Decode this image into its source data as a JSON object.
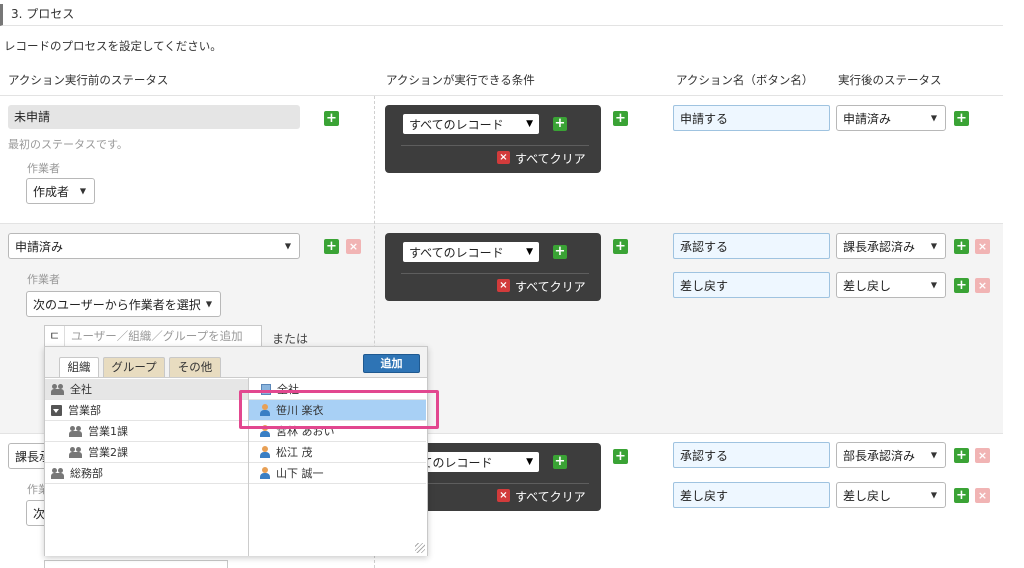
{
  "section": {
    "title": "3. プロセス",
    "description": "レコードのプロセスを設定してください。"
  },
  "columns": {
    "status_before": "アクション実行前のステータス",
    "condition": "アクションが実行できる条件",
    "action_name": "アクション名（ボタン名）",
    "status_after": "実行後のステータス"
  },
  "rows": [
    {
      "status": "未申請",
      "note": "最初のステータスです。",
      "assignee_label": "作業者",
      "assignee_value": "作成者",
      "condition_value": "すべてのレコード",
      "clear_label": "すべてクリア",
      "actions": [
        {
          "name": "申請する",
          "next": "申請済み"
        }
      ]
    },
    {
      "status": "申請済み",
      "assignee_label": "作業者",
      "assignee_value": "次のユーザーから作業者を選択",
      "assignee_input_placeholder": "ユーザー／組織／グループを追加",
      "or_label": "または",
      "condition_value": "すべてのレコード",
      "clear_label": "すべてクリア",
      "actions": [
        {
          "name": "承認する",
          "next": "課長承認済み"
        },
        {
          "name": "差し戻す",
          "next": "差し戻し"
        }
      ]
    },
    {
      "status": "課長承",
      "assignee_label": "作業",
      "assignee_value": "次",
      "condition_value": "べてのレコード",
      "clear_label": "すべてクリア",
      "actions": [
        {
          "name": "承認する",
          "next": "部長承認済み"
        },
        {
          "name": "差し戻す",
          "next": "差し戻し"
        }
      ]
    }
  ],
  "picker": {
    "tabs": [
      "組織",
      "グループ",
      "その他"
    ],
    "add_button": "追加",
    "orgs": [
      {
        "label": "全社",
        "icon": "group-icon",
        "selected": true
      },
      {
        "label": "営業部",
        "icon": "expand-icon"
      },
      {
        "label": "営業1課",
        "icon": "group-icon"
      },
      {
        "label": "営業2課",
        "icon": "group-icon"
      },
      {
        "label": "総務部",
        "icon": "group-icon"
      }
    ],
    "users": [
      {
        "label": "全社",
        "icon": "org-icon"
      },
      {
        "label": "笹川 楽衣",
        "icon": "person-icon",
        "highlighted": true
      },
      {
        "label": "宮林 あおい",
        "icon": "person-icon"
      },
      {
        "label": "松江 茂",
        "icon": "person-icon"
      },
      {
        "label": "山下 誠一",
        "icon": "person-icon"
      }
    ]
  },
  "colors": {
    "accent": "#3aa335",
    "highlight": "#e2478f",
    "panel": "#3d3d3d"
  }
}
